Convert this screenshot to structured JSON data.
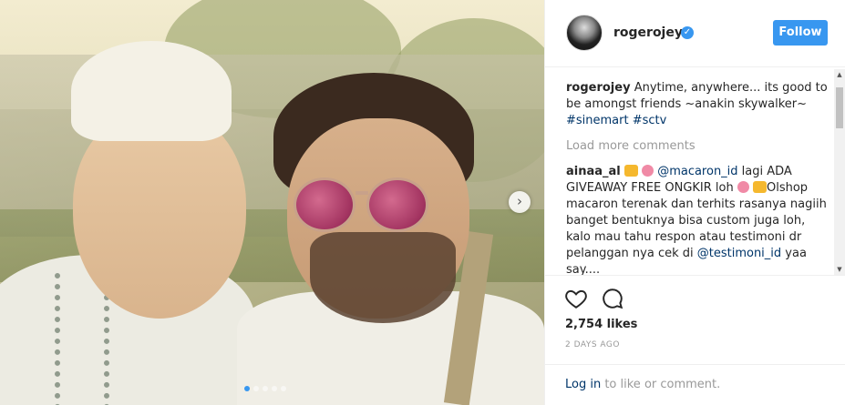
{
  "header": {
    "username": "rogerojey",
    "follow_label": "Follow"
  },
  "caption": {
    "user": "rogerojey",
    "text": " Anytime, anywhere... its good to be amongst friends ~anakin skywalker~ ",
    "tags": [
      "#sinemart",
      "#sctv"
    ]
  },
  "load_more": "Load more comments",
  "comment": {
    "user": "ainaa_al",
    "mention1": "@macaron_id",
    "text1": " lagi ADA GIVEAWAY FREE ONGKIR loh ",
    "text2": "Olshop macaron terenak dan terhits rasanya nagiih banget bentuknya bisa custom juga loh, kalo mau tahu respon atau testimoni dr pelanggan nya cek di ",
    "mention2": "@testimoni_id",
    "text3": " yaa say...."
  },
  "likes": "2,754 likes",
  "date": "2 DAYS AGO",
  "login": {
    "link": "Log in",
    "rest": " to like or comment."
  },
  "colors": {
    "accent": "#3897f0",
    "link": "#003569"
  },
  "icons": {
    "verified": "verified-badge-icon",
    "like": "heart-icon",
    "comment": "comment-bubble-icon",
    "next": "chevron-right-icon"
  }
}
